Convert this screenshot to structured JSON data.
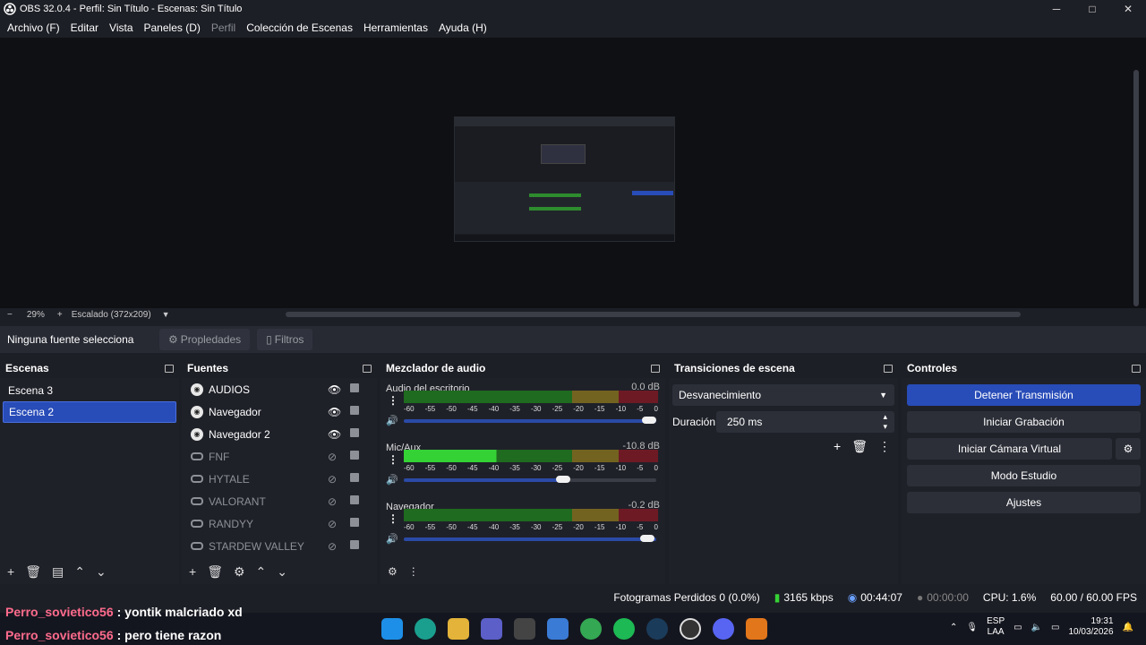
{
  "window": {
    "title": "OBS 32.0.4 - Perfil: Sin Título - Escenas: Sin Título",
    "minimize": "─",
    "maximize": "□",
    "close": "✕"
  },
  "menu": [
    "Archivo (F)",
    "Editar",
    "Vista",
    "Paneles (D)",
    "Perfil",
    "Colección de Escenas",
    "Herramientas",
    "Ayuda (H)"
  ],
  "zoom": {
    "minus": "−",
    "percent": "29%",
    "plus": "+",
    "scale": "Escalado (372x209)"
  },
  "infobar": {
    "no_source": "Ninguna fuente selecciona",
    "props": "Propledades",
    "filters": "Filtros"
  },
  "scenes": {
    "title": "Escenas",
    "items": [
      "Escena 3",
      "Escena 2"
    ],
    "selected": 1
  },
  "sources": {
    "title": "Fuentes",
    "items": [
      "AUDIOS",
      "Navegador",
      "Navegador 2",
      "FNF",
      "HYTALE",
      "VALORANT",
      "RANDYY",
      "STARDEW VALLEY"
    ]
  },
  "mixer": {
    "title": "Mezclador de audio",
    "channels": [
      {
        "name": "Audio del escritorio",
        "db": "0.0 dB",
        "level": 0.0,
        "volume": 1.0
      },
      {
        "name": "Mic/Aux",
        "db": "-10.8 dB",
        "level": 0.36,
        "volume": 0.63
      },
      {
        "name": "Navegador",
        "db": "-0.2 dB",
        "level": 0.0,
        "volume": 0.99
      }
    ],
    "ticks": [
      "-60",
      "-55",
      "-50",
      "-45",
      "-40",
      "-35",
      "-30",
      "-25",
      "-20",
      "-15",
      "-10",
      "-5",
      "0"
    ]
  },
  "transitions": {
    "title": "Transiciones de escena",
    "type": "Desvanecimiento",
    "duration_label": "Duración",
    "duration": "250 ms"
  },
  "controls": {
    "title": "Controles",
    "stop_stream": "Detener Transmisión",
    "start_rec": "Iniciar Grabación",
    "virtual_cam": "Iniciar Cámara Virtual",
    "studio": "Modo Estudio",
    "settings": "Ajustes"
  },
  "status": {
    "dropped": "Fotogramas Perdidos 0 (0.0%)",
    "bitrate": "3165 kbps",
    "stream_time": "00:44:07",
    "rec_time": "00:00:00",
    "cpu": "CPU: 1.6%",
    "fps": "60.00 / 60.00 FPS"
  },
  "chat": [
    {
      "user": "Perro_sovietico56",
      "msg": ": yontik malcriado xd"
    },
    {
      "user": "Perro_sovietico56",
      "msg": ": pero tiene razon"
    }
  ],
  "tray": {
    "lang1": "ESP",
    "lang2": "LAA",
    "time": "19:31",
    "date": "10/03/2026"
  }
}
